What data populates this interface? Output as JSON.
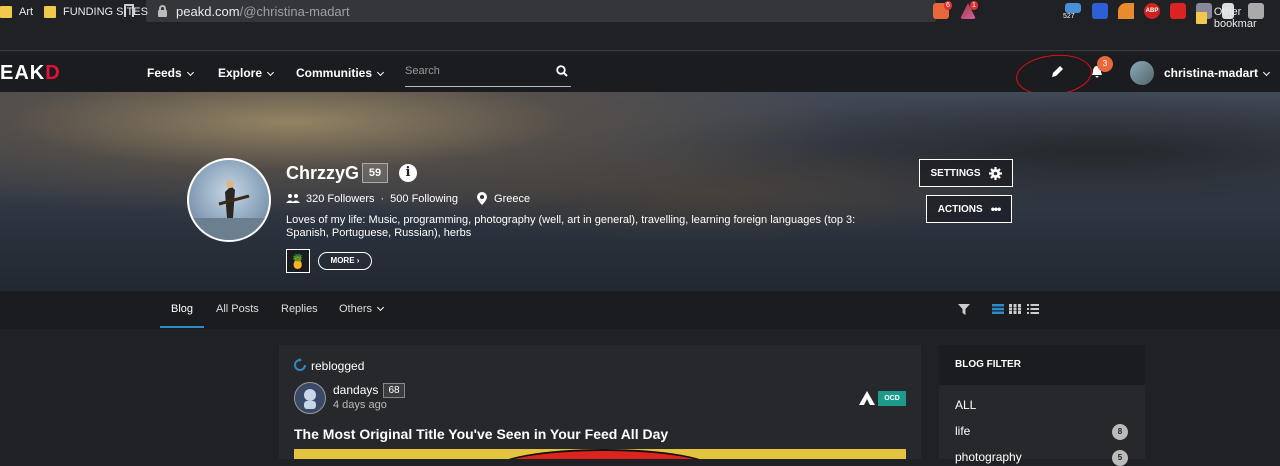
{
  "browser": {
    "url_host": "peakd.com",
    "url_path": "/@christina-madart",
    "ext_counts": {
      "brave": "6",
      "alert": "1",
      "mail": "527"
    },
    "ext_labels": {
      "abp": "ABP"
    },
    "bookmarks": [
      {
        "label": "Art"
      },
      {
        "label": "FUNDING SITES"
      }
    ],
    "other_bookmarks": "Other bookmar"
  },
  "nav": {
    "logo_main": "EAK",
    "logo_accent": "D",
    "links": [
      {
        "label": "Feeds"
      },
      {
        "label": "Explore"
      },
      {
        "label": "Communities"
      }
    ],
    "search_placeholder": "Search",
    "notification_count": "3",
    "username": "christina-madart"
  },
  "profile": {
    "name": "ChrzzyG",
    "reputation": "59",
    "followers": "320 Followers",
    "separator": "·",
    "following": "500 Following",
    "location": "Greece",
    "bio": "Loves of my life: Music, programming, photography (well, art in general), travelling, learning foreign languages (top 3: Spanish, Portuguese, Russian), herbs",
    "more_label": "MORE",
    "settings_label": "SETTINGS",
    "actions_label": "ACTIONS"
  },
  "tabs": [
    {
      "label": "Blog"
    },
    {
      "label": "All Posts"
    },
    {
      "label": "Replies"
    },
    {
      "label": "Others"
    }
  ],
  "post": {
    "reblogged_label": "reblogged",
    "author": "dandays",
    "author_rep": "68",
    "time": "4 days ago",
    "community_badge": "OCD",
    "title": "The Most Original Title You've Seen in Your Feed All Day"
  },
  "blog_filter": {
    "title": "BLOG FILTER",
    "items": [
      {
        "label": "ALL",
        "count": ""
      },
      {
        "label": "life",
        "count": "8"
      },
      {
        "label": "photography",
        "count": "5"
      }
    ]
  },
  "colors": {
    "accent_red": "#e31337",
    "accent_blue": "#2b8ccc",
    "ocd_teal": "#1d9a8c",
    "notif_orange": "#e8673c"
  }
}
